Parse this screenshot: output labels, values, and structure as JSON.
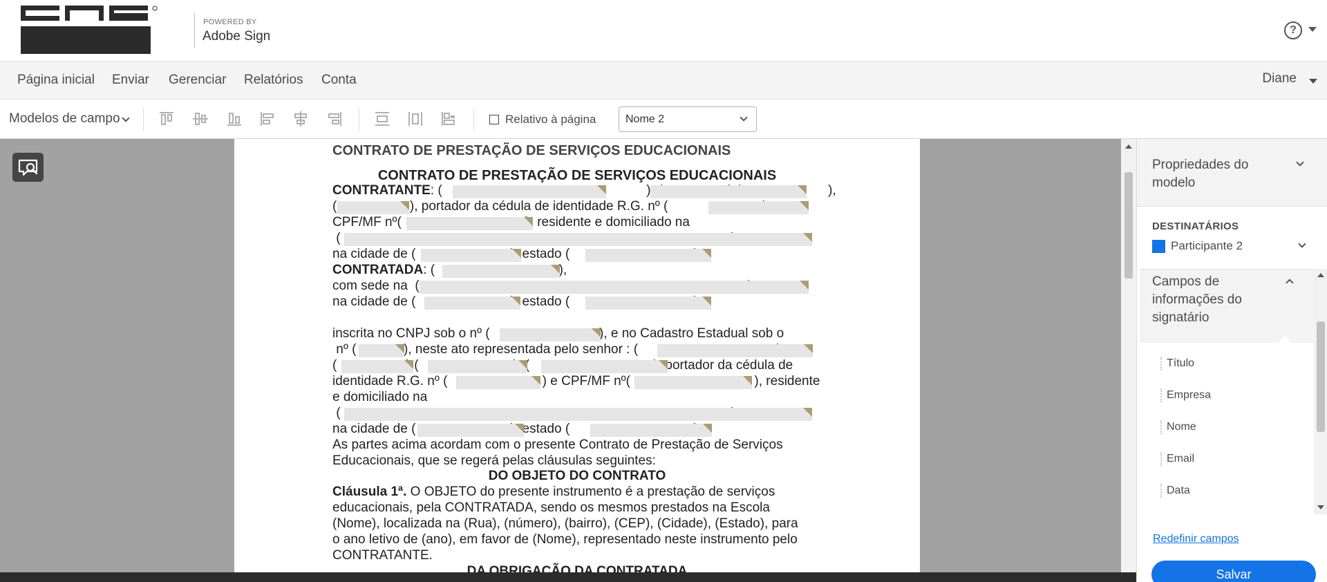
{
  "header": {
    "powered_by": "POWERED BY",
    "product": "Adobe Sign",
    "help": "?"
  },
  "nav": {
    "items": [
      "Página inicial",
      "Enviar",
      "Gerenciar",
      "Relatórios",
      "Conta"
    ],
    "user": "Diane"
  },
  "toolbar": {
    "field_models": "Modelos de campo",
    "relative_to_page": "Relativo à página",
    "recipient_selected": "Nome 2"
  },
  "document": {
    "header_title": "CONTRATO DE PRESTAÇÃO DE SERVIÇOS EDUCACIONAIS",
    "title": "CONTRATO DE PRESTAÇÃO DE SERVIÇOS EDUCACIONAIS",
    "contratante_label": "CONTRATANTE",
    "line1": ": (                                                        ), (                  ),(                        ),",
    "line2": "(                    ), portador da cédula de identidade R.G. nº (                          ) e",
    "line3": "CPF/MF nº(                                  ), residente e domiciliado na",
    "line4": " (                                                                                                           ),",
    "line5": "na cidade de (                          ), estado (                                  );",
    "contratada_label": "CONTRATADA",
    "line6": ": (                                  ),",
    "line7": "com sede na  (                                                                                          ),",
    "line8": "na cidade de (                          ), estado (                                  ).",
    "line9": "inscrita no CNPJ sob o nº (                              ), e no Cadastro Estadual sob o",
    "line10": " nº (             ), neste ato representada pelo senhor : (                                      ),",
    "line11": "(                   ),(                          ), (                                  ), portador da cédula de",
    "line12": "identidade R.G. nº (                          ) e CPF/MF nº(                                  ), residente",
    "line13": "e domiciliado na",
    "line14": " (                                                                                                           ),",
    "line15": "na cidade de (                          ), estado (                                  );",
    "line16": "As partes acima acordam com o presente Contrato de Prestação de Serviços",
    "line17": "Educacionais, que se regerá pelas cláusulas seguintes:",
    "section1": "DO OBJETO DO CONTRATO",
    "clause1_label": "Cláusula 1ª.",
    "line18": " O OBJETO do presente instrumento é a prestação de serviços",
    "line19": "educacionais, pela CONTRATADA, sendo os mesmos prestados na Escola",
    "line20": "(Nome), localizada na (Rua), (número), (bairro), (CEP), (Cidade), (Estado), para",
    "line21": "o ano letivo de (ano), em favor de (Nome), representado neste instrumento pelo",
    "line22": "CONTRATANTE.",
    "section2": "DA OBRIGAÇÃO DA CONTRATADA"
  },
  "panel": {
    "title": "Propriedades do modelo",
    "recipients_label": "DESTINATÁRIOS",
    "participant": "Participante 2",
    "participant_color": "#1473e6",
    "fields_title": "Campos de informações do signatário",
    "fields": [
      "Título",
      "Empresa",
      "Nome",
      "Email",
      "Data"
    ],
    "reset": "Redefinir campos",
    "save": "Salvar"
  }
}
